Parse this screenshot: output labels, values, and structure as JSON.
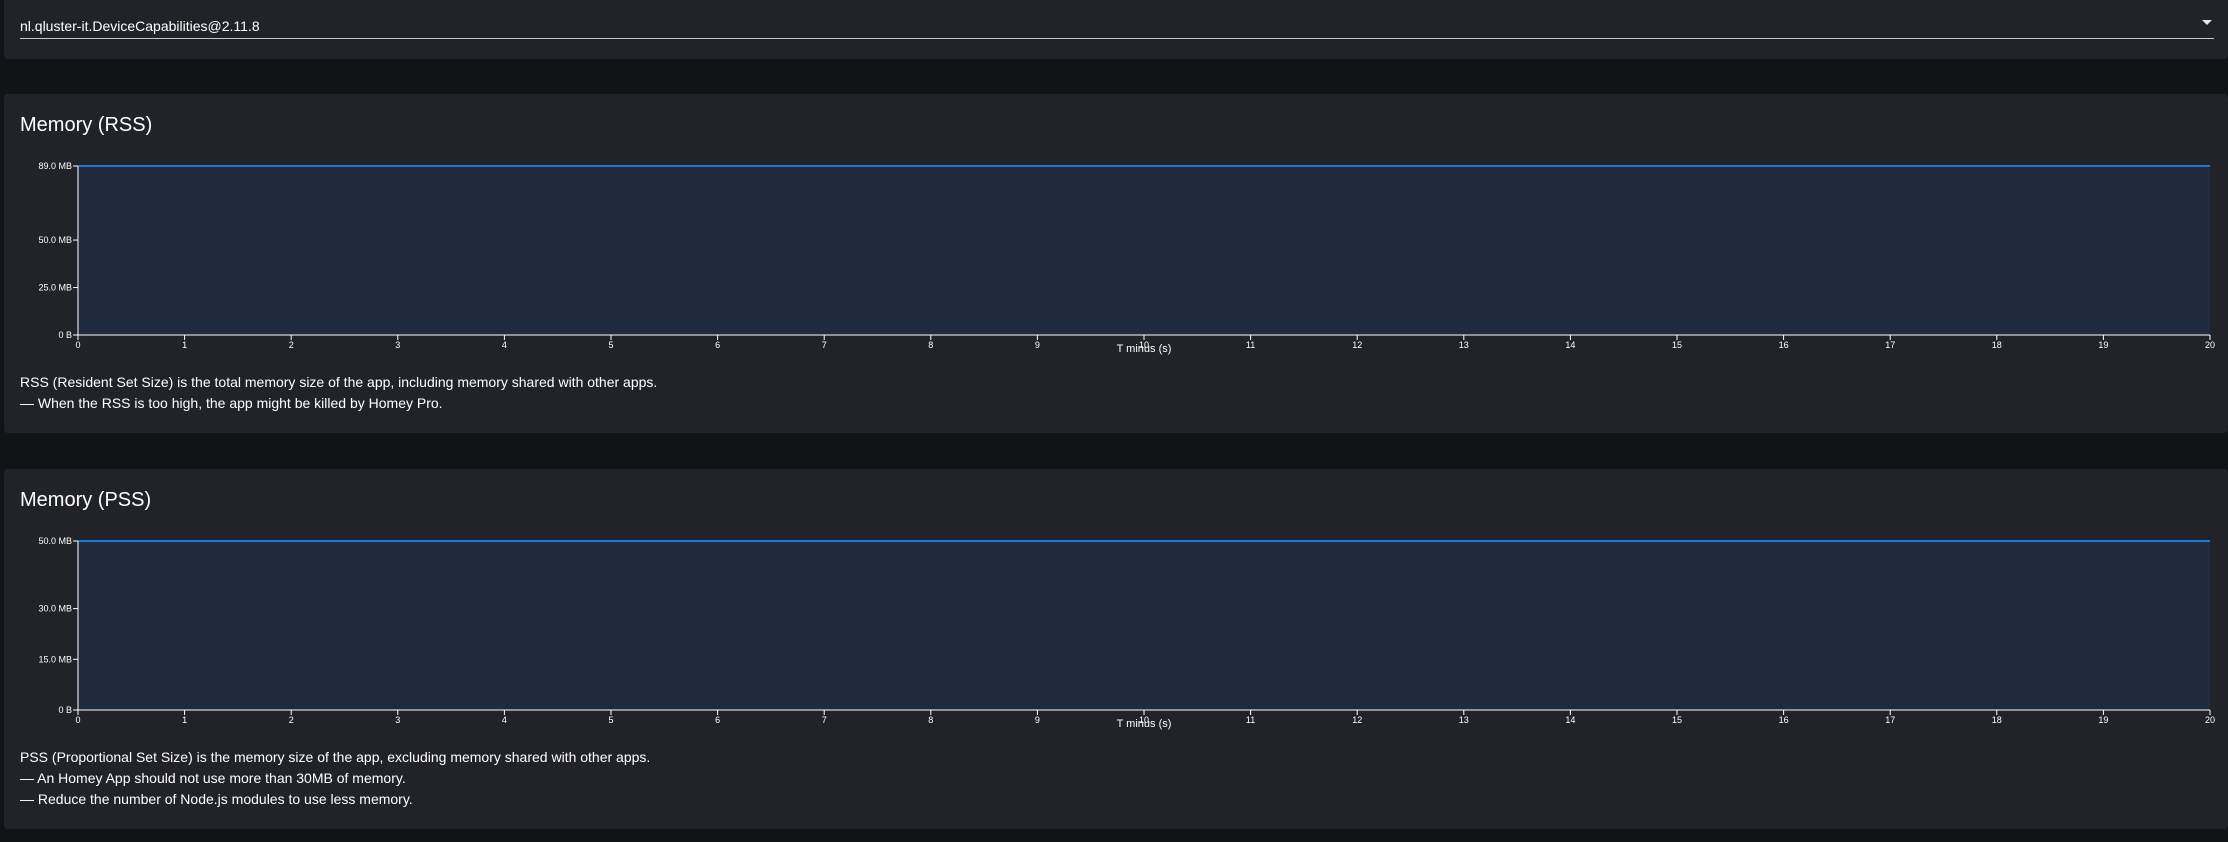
{
  "selector": {
    "value": "nl.qluster-it.DeviceCapabilities@2.11.8",
    "icon": "chevron-down-icon"
  },
  "colors": {
    "line": "#1f77d4",
    "area": "#1f2a3f",
    "axis": "#ffffff",
    "card": "#222328",
    "background": "#121317"
  },
  "rss": {
    "title": "Memory (RSS)",
    "description": [
      "RSS (Resident Set Size) is the total memory size of the app, including memory shared with other apps.",
      "— When the RSS is too high, the app might be killed by Homey Pro."
    ]
  },
  "pss": {
    "title": "Memory (PSS)",
    "description": [
      "PSS (Proportional Set Size) is the memory size of the app, excluding memory shared with other apps.",
      "— An Homey App should not use more than 30MB of memory.",
      "— Reduce the number of Node.js modules to use less memory."
    ]
  },
  "chart_data": [
    {
      "type": "area",
      "title": "Memory (RSS)",
      "xlabel": "T minus (s)",
      "ylabel": "",
      "xlim": [
        0,
        20
      ],
      "ylim": [
        0,
        89
      ],
      "x_ticks": [
        0,
        1,
        2,
        3,
        4,
        5,
        6,
        7,
        8,
        9,
        10,
        11,
        12,
        13,
        14,
        15,
        16,
        17,
        18,
        19,
        20
      ],
      "y_ticks": [
        {
          "value": 0,
          "label": "0 B"
        },
        {
          "value": 25,
          "label": "25.0 MB"
        },
        {
          "value": 50,
          "label": "50.0 MB"
        },
        {
          "value": 89,
          "label": "89.0 MB"
        }
      ],
      "grid": false,
      "series": [
        {
          "x": [
            0,
            1,
            2,
            3,
            4,
            5,
            6,
            7,
            8,
            9,
            10,
            11,
            12,
            13,
            14,
            15,
            16,
            17,
            18,
            19,
            20
          ],
          "values": [
            89,
            89,
            89,
            89,
            89,
            89,
            89,
            89,
            89,
            89,
            89,
            89,
            89,
            89,
            89,
            89,
            89,
            89,
            89,
            89,
            89
          ]
        }
      ]
    },
    {
      "type": "area",
      "title": "Memory (PSS)",
      "xlabel": "T minus (s)",
      "ylabel": "",
      "xlim": [
        0,
        20
      ],
      "ylim": [
        0,
        50
      ],
      "x_ticks": [
        0,
        1,
        2,
        3,
        4,
        5,
        6,
        7,
        8,
        9,
        10,
        11,
        12,
        13,
        14,
        15,
        16,
        17,
        18,
        19,
        20
      ],
      "y_ticks": [
        {
          "value": 0,
          "label": "0 B"
        },
        {
          "value": 15,
          "label": "15.0 MB"
        },
        {
          "value": 30,
          "label": "30.0 MB"
        },
        {
          "value": 50,
          "label": "50.0 MB"
        }
      ],
      "grid": false,
      "series": [
        {
          "x": [
            0,
            1,
            2,
            3,
            4,
            5,
            6,
            7,
            8,
            9,
            10,
            11,
            12,
            13,
            14,
            15,
            16,
            17,
            18,
            19,
            20
          ],
          "values": [
            50,
            50,
            50,
            50,
            50,
            50,
            50,
            50,
            50,
            50,
            50,
            50,
            50,
            50,
            50,
            50,
            50,
            50,
            50,
            50,
            50
          ]
        }
      ]
    }
  ]
}
